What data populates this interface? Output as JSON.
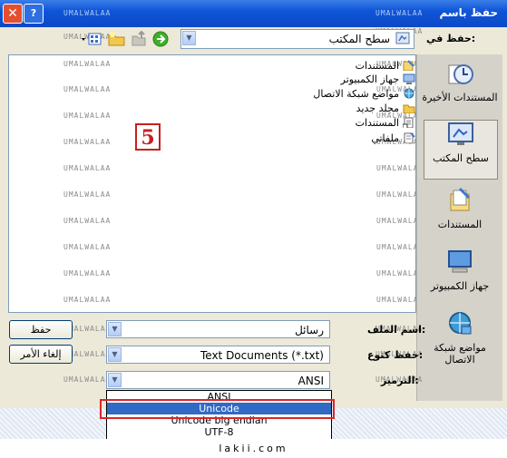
{
  "window": {
    "title": "حفظ باسم",
    "close_glyph": "✕",
    "help_glyph": "?"
  },
  "watermark": "UMALWALAA",
  "toolbar": {
    "save_in_label": "حفظ في:",
    "save_in_value": "سطح المكتب"
  },
  "files": [
    "المستندات",
    "جهاز الكمبيوتر",
    "مواضع شبكة الاتصال",
    "مجلد جديد",
    "المستندات",
    "ملفاتي"
  ],
  "places": [
    "المستندات الأخيرة",
    "سطح المكتب",
    "المستندات",
    "جهاز الكمبيوتر",
    "مواضع شبكة الاتصال"
  ],
  "form": {
    "filename_label": "اسم الملف:",
    "filename_value": "رسائل",
    "type_label": "حفظ كنوع:",
    "type_value": "Text Documents (*.txt)",
    "encoding_label": "الترميز:",
    "encoding_value": "ANSI"
  },
  "buttons": {
    "save": "حفظ",
    "cancel": "إلغاء الأمر"
  },
  "encoding_options": [
    "ANSI",
    "Unicode",
    "Unicode big endian",
    "UTF-8"
  ],
  "selected_encoding": "Unicode",
  "step_badge": "5",
  "footer": "lakii.com",
  "colors": {
    "title_bar": "#0f55d8",
    "selection": "#316ac5",
    "highlight": "#d9262b"
  }
}
